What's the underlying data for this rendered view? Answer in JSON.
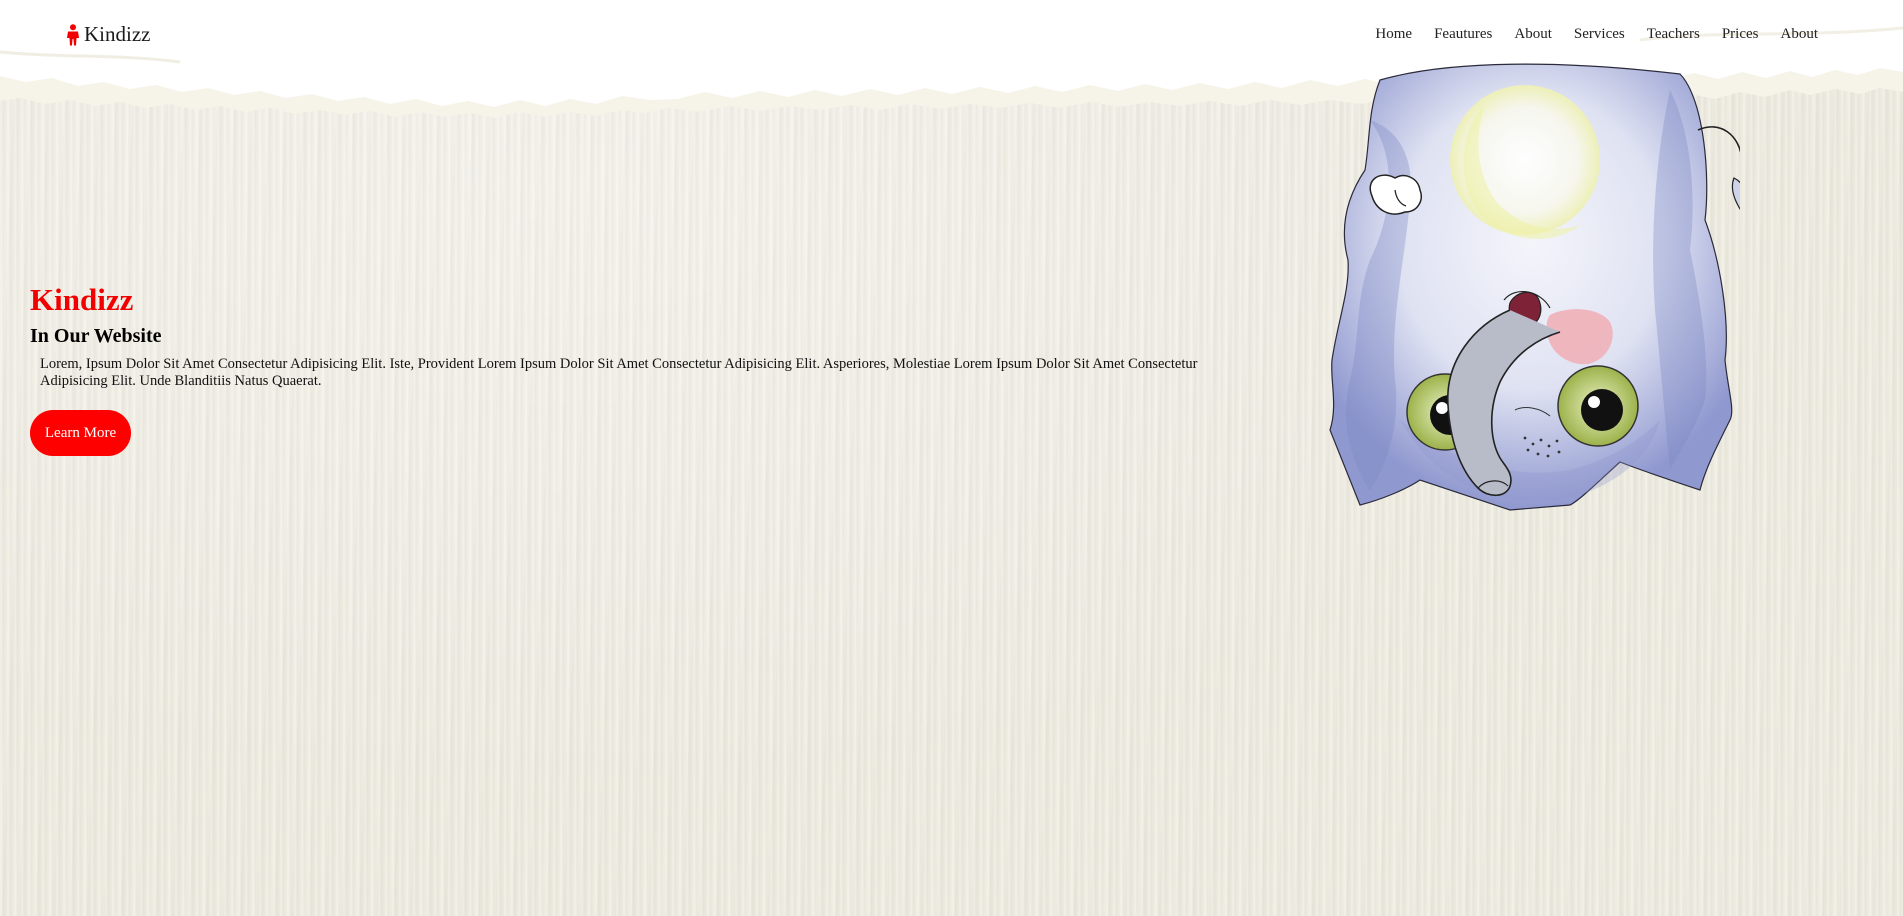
{
  "navbar": {
    "brand": "Kindizz",
    "links": [
      "Home",
      "Feautures",
      "About",
      "Services",
      "Teachers",
      "Prices",
      "About"
    ]
  },
  "hero": {
    "title": "Kindizz",
    "subtitle": "In Our Website",
    "text": "Lorem, Ipsum Dolor Sit Amet Consectetur Adipisicing Elit. Iste, Provident Lorem Ipsum Dolor Sit Amet Consectetur Adipisicing Elit. Asperiores, Molestiae Lorem Ipsum Dolor Sit Amet Consectetur Adipisicing Elit. Unde Blanditiis Natus Quaerat.",
    "button": "Learn More"
  },
  "icons": {
    "brand": "child-icon",
    "illustration": "upside-down-cat-illustration"
  },
  "colors": {
    "accent": "#ff0000",
    "background": "#eeebe0",
    "header": "#ffffff"
  }
}
